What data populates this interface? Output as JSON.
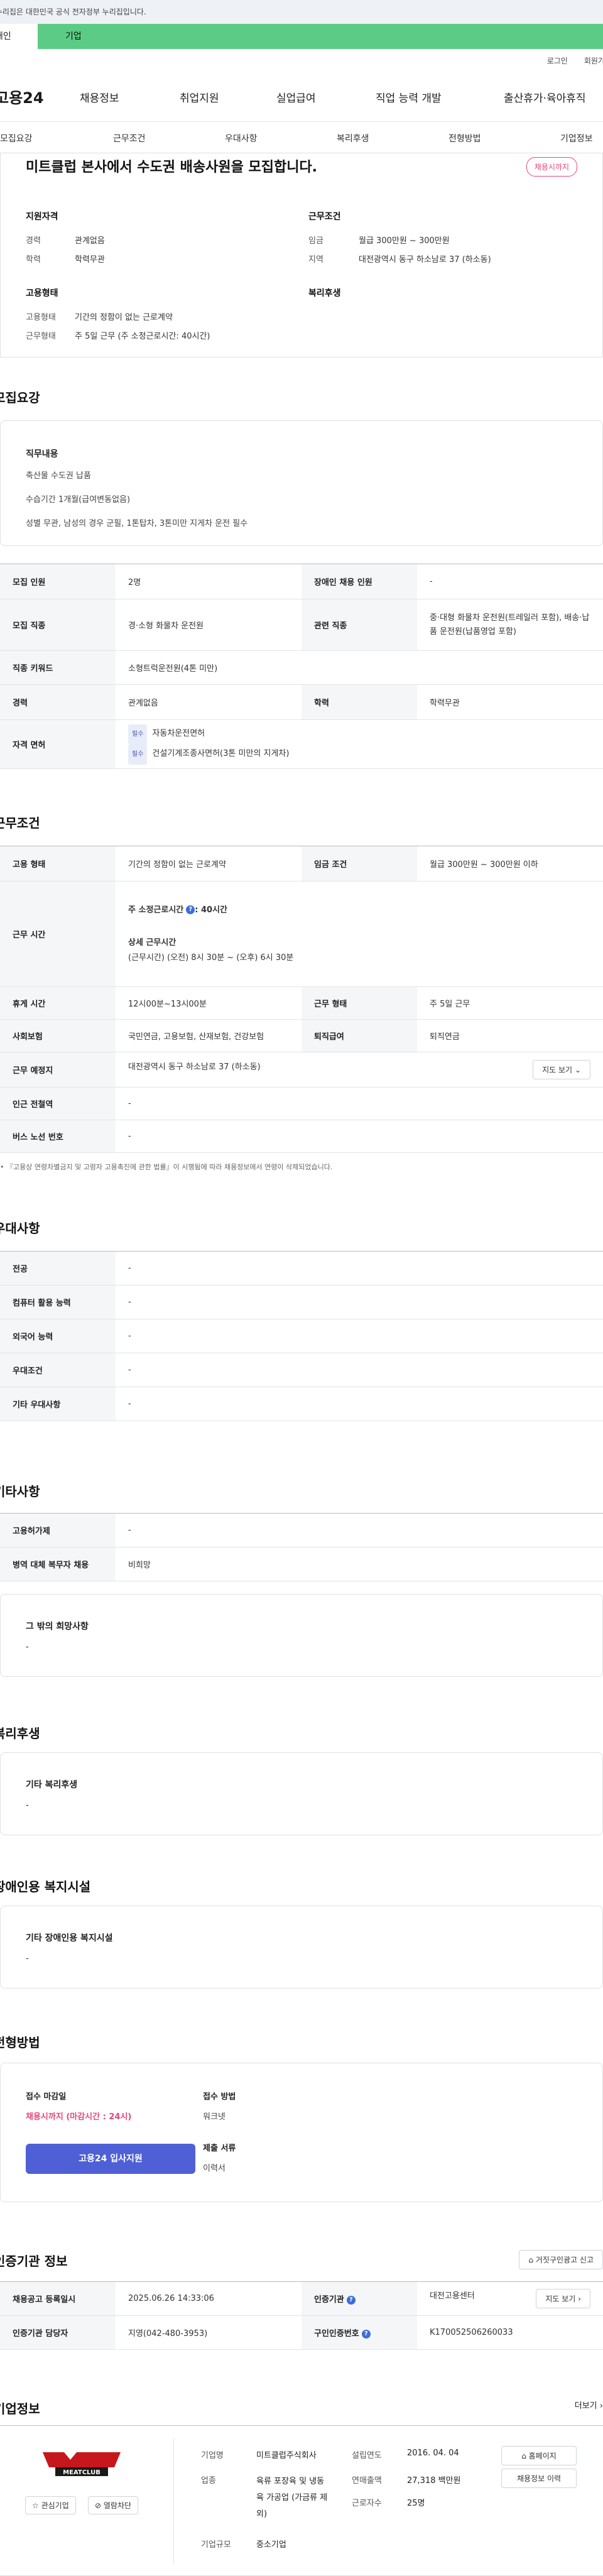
{
  "gov_banner": "이 누리집은 대한민국 공식 전자정부 누리집입니다.",
  "site_tabs": [
    "개인",
    "기업"
  ],
  "util": [
    "로그인",
    "회원가입"
  ],
  "logo": "고용24",
  "gnb": [
    "채용정보",
    "취업지원",
    "실업급여",
    "직업 능력 개발",
    "출산휴가·육아휴직"
  ],
  "subtabs": [
    "모집요강",
    "근무조건",
    "우대사항",
    "복리후생",
    "전형방법",
    "기업정보"
  ],
  "summary": {
    "title": "미트클럽 본사에서 수도권 배송사원을 모집합니다.",
    "badge": "채용시까지",
    "qual_heading": "지원자격",
    "qual": [
      {
        "k": "경력",
        "v": "관계없음"
      },
      {
        "k": "학력",
        "v": "학력무관"
      }
    ],
    "cond_heading": "근무조건",
    "cond": [
      {
        "k": "임금",
        "v": "월급 300만원 ~ 300만원"
      },
      {
        "k": "지역",
        "v": "대전광역시 동구 하소남로 37 (하소동)"
      }
    ],
    "emp_heading": "고용형태",
    "emp": [
      {
        "k": "고용형태",
        "v": "기간의 정함이 없는 근로계약"
      },
      {
        "k": "근무형태",
        "v": "주 5일 근무 (주 소정근로시간: 40시간)"
      }
    ],
    "welfare_heading": "복리후생"
  },
  "recruit": {
    "title": "모집요강",
    "duty_heading": "직무내용",
    "duty_lines": [
      "축산물 수도권 납품",
      "수습기간 1개월(급여변동없음)",
      "성별 무관, 남성의 경우 군필, 1톤탑차, 3톤미만 지게차 운전 필수"
    ],
    "rows": [
      {
        "k1": "모집 인원",
        "v1": "2명",
        "k2": "장애인 채용 인원",
        "v2": "-"
      },
      {
        "k1": "모집 직종",
        "v1": "경·소형 화물차 운전원",
        "k2": "관련 직종",
        "v2": "중·대형 화물차 운전원(트레일러 포함), 배송·납품 운전원(납품영업 포함)"
      },
      {
        "k1": "직종 키워드",
        "v1": "소형트럭운전원(4톤 미만)"
      },
      {
        "k1": "경력",
        "v1": "관계없음",
        "k2": "학력",
        "v2": "학력무관"
      }
    ],
    "license_label": "자격 면허",
    "licenses": [
      {
        "tag": "필수",
        "name": "자동차운전면허"
      },
      {
        "tag": "필수",
        "name": "건설기계조종사면허(3톤 미만의 지게차)"
      }
    ]
  },
  "work": {
    "title": "근무조건",
    "emp_type_k": "고용 형태",
    "emp_type_v": "기간의 정함이 없는 근로계약",
    "wage_k": "임금 조건",
    "wage_v": "월급 300만원 ~ 300만원 이하",
    "hours_k": "근무 시간",
    "hours_main": "주 소정근로시간",
    "hours_main_v": ": 40시간",
    "hours_detail_label": "상세 근무시간",
    "hours_detail": "(근무시간) (오전) 8시 30분 ~ (오후) 6시 30분",
    "break_k": "휴게 시간",
    "break_v": "12시00분~13시00분",
    "worktype_k": "근무 형태",
    "worktype_v": "주 5일 근무",
    "insurance_k": "사회보험",
    "insurance_v": "국민연금, 고용보험, 산재보험, 건강보험",
    "retire_k": "퇴직급여",
    "retire_v": "퇴직연금",
    "place_k": "근무 예정지",
    "place_v": "대전광역시 동구 하소남로 37 (하소동)",
    "map_btn": "지도 보기",
    "subway_k": "인근 전철역",
    "subway_v": "-",
    "bus_k": "버스 노선 번호",
    "bus_v": "-",
    "notice": "『고용상 연령차별금지 및 고령자 고용촉진에 관한 법률』이 시행됨에 따라 채용정보에서 연령이 삭제되었습니다."
  },
  "pref": {
    "title": "우대사항",
    "rows": [
      {
        "k": "전공",
        "v": "-"
      },
      {
        "k": "컴퓨터 활용 능력",
        "v": "-"
      },
      {
        "k": "외국어 능력",
        "v": "-"
      },
      {
        "k": "우대조건",
        "v": "-"
      },
      {
        "k": "기타 우대사항",
        "v": "-"
      }
    ]
  },
  "etc": {
    "title": "기타사항",
    "rows": [
      {
        "k": "고용허가제",
        "v": "-"
      },
      {
        "k": "병역 대체 복무자 채용",
        "v": "비희망"
      }
    ],
    "other_label": "그 밖의 희망사항",
    "other_value": "-"
  },
  "welfare": {
    "title": "복리후생",
    "label": "기타 복리후생",
    "value": "-"
  },
  "disab": {
    "title": "장애인용 복지시설",
    "label": "기타 장애인용 복지시설",
    "value": "-"
  },
  "process": {
    "title": "전형방법",
    "deadline_label": "접수 마감일",
    "deadline_value": "채용시까지 (마감시간 : 24시)",
    "apply_btn": "고용24 입사지원",
    "method_label": "접수 방법",
    "method_value": "워크넷",
    "docs_label": "제출 서류",
    "docs_value": "이력서"
  },
  "cert": {
    "title": "인증기관 정보",
    "report_btn": "거짓구인광고 신고",
    "reg_k": "채용공고 등록일시",
    "reg_v": "2025.06.26 14:33:06",
    "org_k": "인증기관",
    "org_v": "대전고용센터",
    "map_btn": "지도 보기",
    "mgr_k": "인증기관 담당자",
    "mgr_v": "지영(042-480-3953)",
    "num_k": "구인인증번호",
    "num_v": "K170052506260033"
  },
  "company": {
    "title": "기업정보",
    "more": "더보기",
    "logo_text": "MEATCLUB",
    "fav_btn": "관심기업",
    "block_btn": "열람차단",
    "fields": [
      {
        "k": "기업명",
        "v": "미트클럽주식회사"
      },
      {
        "k": "업종",
        "v": "육류 포장육 및 냉동육 가공업 (가금류 제외)"
      },
      {
        "k": "기업규모",
        "v": "중소기업"
      }
    ],
    "fields2": [
      {
        "k": "설립연도",
        "v": "2016. 04. 04"
      },
      {
        "k": "연매출액",
        "v": "27,318 백만원"
      },
      {
        "k": "근로자수",
        "v": "25명"
      }
    ],
    "homepage_btn": "홈페이지",
    "history_btn": "채용정보 이력"
  },
  "colors": {
    "accent_green": "#5ccb85",
    "brand_blue": "#4f5fd6",
    "deadline_red": "#e8467a"
  }
}
